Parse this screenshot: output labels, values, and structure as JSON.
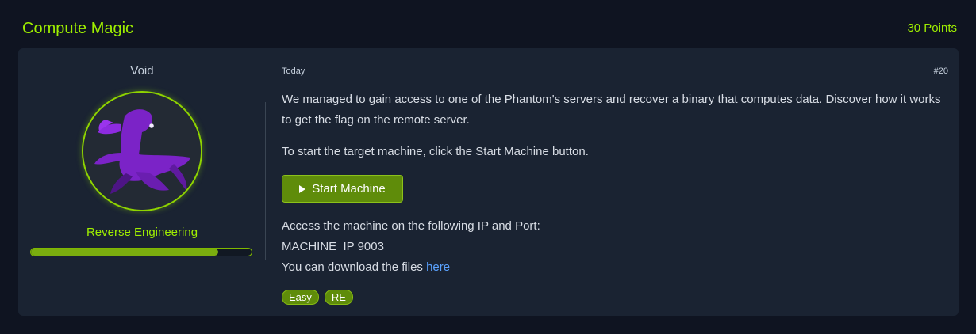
{
  "header": {
    "title": "Compute Magic",
    "points": "30 Points"
  },
  "author": {
    "name": "Void",
    "category": "Reverse Engineering",
    "progress": 0.85
  },
  "task": {
    "date": "Today",
    "number": "#20",
    "description": "We managed to gain access to one of the Phantom's servers and recover a binary that computes data. Discover how it works to get the flag on the remote server.",
    "start_instruction": "To start the target machine, click the Start Machine button.",
    "start_button_label": "Start Machine",
    "access_line": "Access the machine on the following IP and Port:",
    "machine_ip": "MACHINE_IP 9003",
    "download_prefix": "You can download the files ",
    "download_link_text": "here"
  },
  "tags": [
    "Easy",
    "RE"
  ],
  "colors": {
    "accent": "#9fef00",
    "button": "#5f8c0a",
    "link": "#5aa2ff",
    "card": "#1a2332",
    "background": "#0f1421"
  },
  "icons": {
    "avatar": "purple-figure-avatar",
    "start_button": "play-icon"
  }
}
